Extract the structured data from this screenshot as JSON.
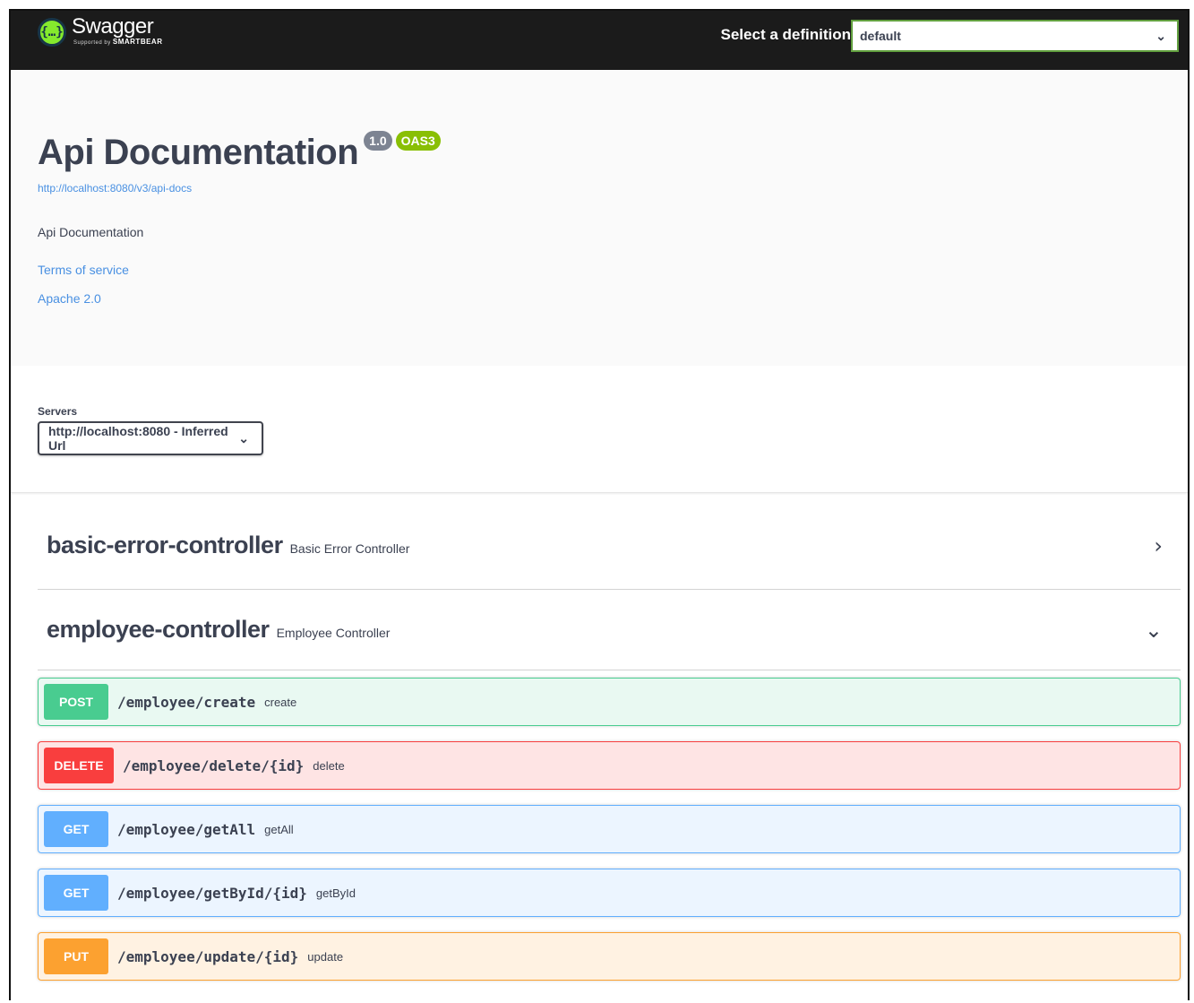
{
  "topbar": {
    "logo_word": "Swagger",
    "logo_sub_prefix": "Supported by",
    "logo_sub_brand": "SMARTBEAR",
    "definition_label": "Select a definition",
    "definition_value": "default"
  },
  "info": {
    "title": "Api Documentation",
    "version_badge": "1.0",
    "oas_badge": "OAS3",
    "spec_url": "http://localhost:8080/v3/api-docs",
    "description": "Api Documentation",
    "terms_link": "Terms of service",
    "license_link": "Apache 2.0"
  },
  "servers": {
    "label": "Servers",
    "selected": "http://localhost:8080 - Inferred Url"
  },
  "tags": [
    {
      "name": "basic-error-controller",
      "description": "Basic Error Controller",
      "expanded": false
    },
    {
      "name": "employee-controller",
      "description": "Employee Controller",
      "expanded": true
    }
  ],
  "operations": [
    {
      "method": "POST",
      "path": "/employee/create",
      "summary": "create"
    },
    {
      "method": "DELETE",
      "path": "/employee/delete/{id}",
      "summary": "delete"
    },
    {
      "method": "GET",
      "path": "/employee/getAll",
      "summary": "getAll"
    },
    {
      "method": "GET",
      "path": "/employee/getById/{id}",
      "summary": "getById"
    },
    {
      "method": "PUT",
      "path": "/employee/update/{id}",
      "summary": "update"
    }
  ],
  "colors": {
    "post": "#49cc90",
    "delete": "#f93e3e",
    "get": "#61affe",
    "put": "#fca130",
    "link": "#4990e2",
    "version_badge": "#7d8492",
    "oas_badge": "#89bf04"
  }
}
